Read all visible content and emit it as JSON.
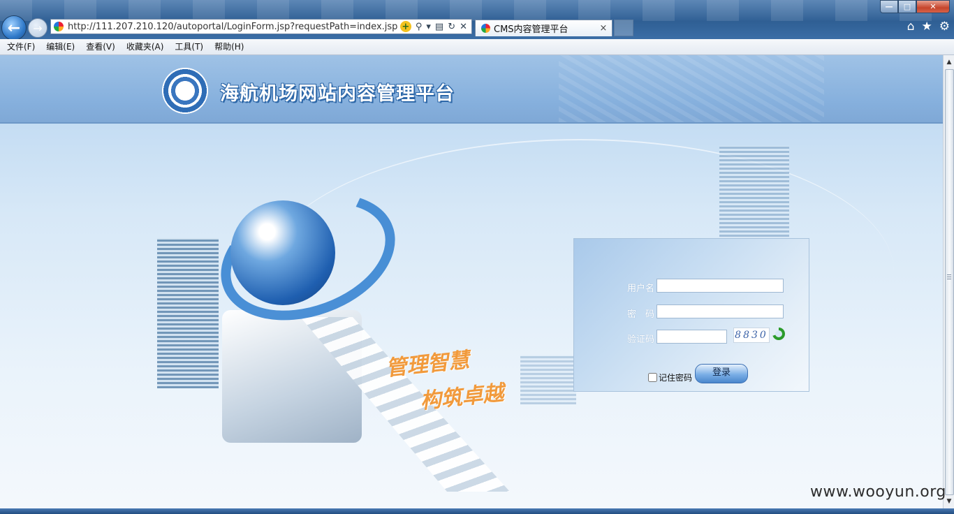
{
  "browser": {
    "address": "http://111.207.210.120/autoportal/LoginForm.jsp?requestPath=index.jsp",
    "tab_title": "CMS内容管理平台",
    "tab_close": "×",
    "window_controls": {
      "minimize": "—",
      "maximize": "□",
      "close": "✕"
    },
    "toolbar_icons": [
      "home-icon",
      "star-icon",
      "gear-icon"
    ]
  },
  "menu": {
    "items": [
      "文件(F)",
      "编辑(E)",
      "查看(V)",
      "收藏夹(A)",
      "工具(T)",
      "帮助(H)"
    ]
  },
  "header": {
    "title": "海航机场网站内容管理平台"
  },
  "slogan": {
    "line1": "管理智慧",
    "line2": "构筑卓越"
  },
  "login": {
    "username_label": "用户名",
    "password_label": "密　码",
    "captcha_label": "验证码",
    "username_value": "",
    "password_value": "",
    "captcha_value": "",
    "captcha_image_text": "8830",
    "remember_label": "记住密码",
    "submit_label": "登录"
  },
  "watermark": "www.wooyun.org",
  "colors": {
    "banner": "#86b0dd",
    "title_outline": "#2d67a8",
    "slogan": "#f19a3c",
    "button": "#4a86cc"
  }
}
